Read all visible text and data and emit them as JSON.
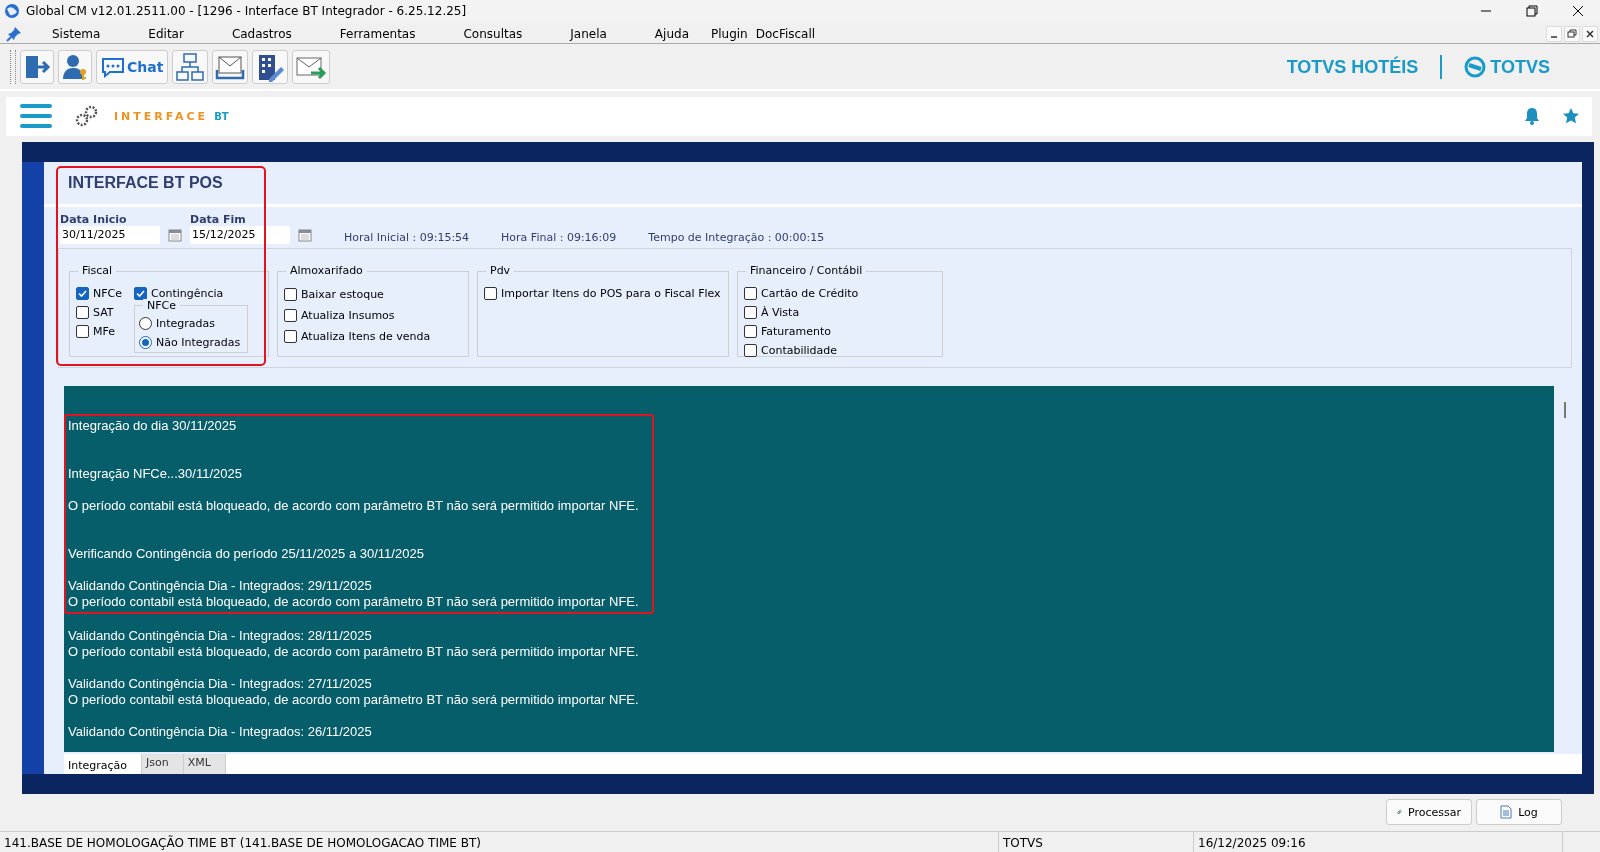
{
  "window": {
    "title": "Global CM v12.01.2511.00 - [1296 - Interface BT Integrador - 6.25.12.25]"
  },
  "menu": [
    "Sistema",
    "Editar",
    "Cadastros",
    "Ferramentas",
    "Consultas",
    "Janela",
    "Ajuda",
    "Plugin",
    "DocFiscall"
  ],
  "toolbar": {
    "chat_label": "Chat",
    "brand": "TOTVS HOTÉIS",
    "logo": "TOTVS"
  },
  "app_header": {
    "title": "INTERFACE",
    "suffix": "BT"
  },
  "form": {
    "title": "INTERFACE BT POS",
    "highlighted": true,
    "date_start": {
      "label": "Data Inicio",
      "value": "30/11/2025"
    },
    "date_end": {
      "label": "Data Fim",
      "value": "15/12/2025"
    },
    "times": [
      "Horal Inicial : 09:15:54",
      "Hora Final : 09:16:09",
      "Tempo de Integração :  00:00:15"
    ],
    "groups": [
      {
        "title": "Fiscal",
        "kind": "fiscal",
        "items": [
          {
            "label": "NFCe",
            "checked": true
          },
          {
            "label": "SAT",
            "checked": false
          },
          {
            "label": "MFe",
            "checked": false
          },
          {
            "label": "Contingência",
            "checked": true
          }
        ],
        "subgroup": {
          "title": "NFCe",
          "options": [
            {
              "label": "Integradas",
              "selected": false
            },
            {
              "label": "Não Integradas",
              "selected": true
            }
          ]
        }
      },
      {
        "title": "Almoxarifado",
        "kind": "list",
        "items": [
          {
            "label": "Baixar estoque",
            "checked": false
          },
          {
            "label": "Atualiza Insumos",
            "checked": false
          },
          {
            "label": "Atualiza Itens de venda",
            "checked": false
          }
        ]
      },
      {
        "title": "Pdv",
        "kind": "list",
        "items": [
          {
            "label": "Importar Itens do POS para o Fiscal Flex",
            "checked": false
          }
        ]
      },
      {
        "title": "Financeiro / Contábil",
        "kind": "list",
        "items": [
          {
            "label": "Cartão de Crédito",
            "checked": false
          },
          {
            "label": "À Vista",
            "checked": false
          },
          {
            "label": "Faturamento",
            "checked": false
          },
          {
            "label": "Contabilidade",
            "checked": false
          }
        ]
      }
    ]
  },
  "log": [
    {
      "kind": "section",
      "highlighted": true,
      "lines": [
        "Integração do dia 30/11/2025"
      ]
    },
    {
      "kind": "entry",
      "highlighted": true,
      "lines": [
        "Integração NFCe...30/11/2025"
      ]
    },
    {
      "kind": "section",
      "highlighted": true,
      "lines": [
        "O período contabil está bloqueado, de acordo com parâmetro BT não será permitido importar NFE."
      ]
    },
    {
      "kind": "entry",
      "highlighted": true,
      "lines": [
        "Verificando Contingência do período 25/11/2025 a 30/11/2025"
      ]
    },
    {
      "kind": "entry",
      "highlighted": true,
      "lines": [
        "Validando Contingência Dia -  Integrados: 29/11/2025",
        "O período contabil está bloqueado, de acordo com parâmetro BT não será permitido importar NFE."
      ]
    },
    {
      "kind": "entry",
      "highlighted": false,
      "lines": [
        "Validando Contingência Dia -  Integrados: 28/11/2025",
        "O período contabil está bloqueado, de acordo com parâmetro BT não será permitido importar NFE."
      ]
    },
    {
      "kind": "entry",
      "highlighted": false,
      "lines": [
        "Validando Contingência Dia -  Integrados: 27/11/2025",
        "O período contabil está bloqueado, de acordo com parâmetro BT não será permitido importar NFE."
      ]
    },
    {
      "kind": "entry",
      "highlighted": false,
      "lines": [
        "Validando Contingência Dia -  Integrados: 26/11/2025"
      ]
    }
  ],
  "tabs": [
    {
      "label": "Integração",
      "selected": true
    },
    {
      "label": "Json",
      "selected": false
    },
    {
      "label": "XML",
      "selected": false
    }
  ],
  "buttons": [
    {
      "label": "Processar",
      "kind": "process"
    },
    {
      "label": "Log",
      "kind": "log"
    }
  ],
  "status_bar": [
    "141.BASE DE HOMOLOGAÇÃO TIME BT  (141.BASE DE HOMOLOGACAO TIME BT)",
    "TOTVS",
    "16/12/2025 09:16"
  ]
}
